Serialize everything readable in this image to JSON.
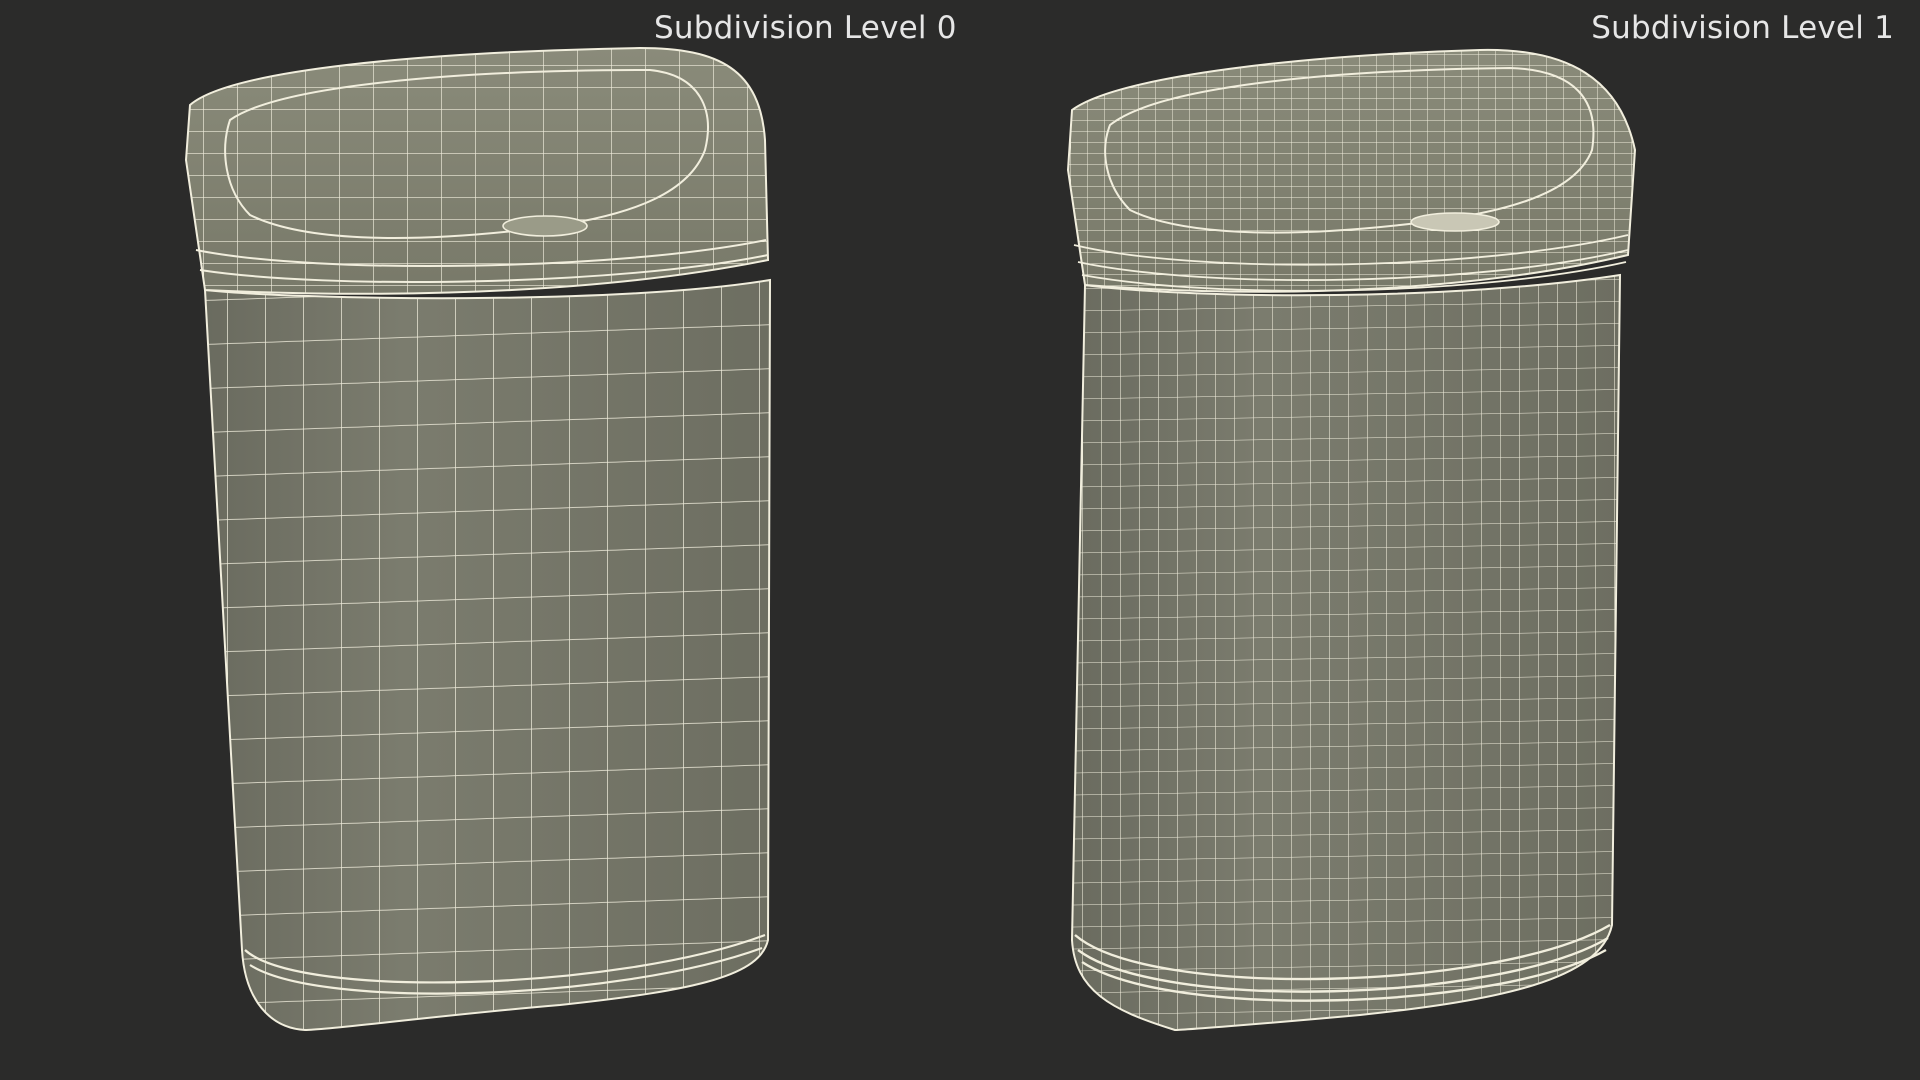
{
  "viewport": {
    "background": "#2b2b2a"
  },
  "panels": [
    {
      "label": "Subdivision Level 0",
      "model": "trash-can",
      "subdivision_level": 0
    },
    {
      "label": "Subdivision Level 1",
      "model": "trash-can",
      "subdivision_level": 1
    }
  ],
  "colors": {
    "caption_text": "#e6e6e6",
    "body_fill": "#76776a",
    "lid_fill": "#838473",
    "shadow_fill": "#666759",
    "wire": "#f1eedd"
  }
}
